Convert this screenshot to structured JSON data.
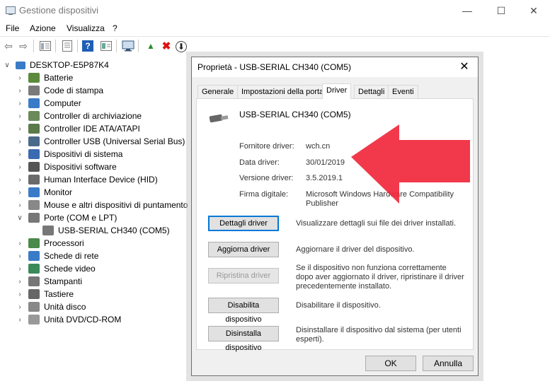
{
  "window": {
    "title": "Gestione dispositivi",
    "minimize_glyph": "—",
    "maximize_glyph": "☐",
    "close_glyph": "✕"
  },
  "menu": [
    "File",
    "Azione",
    "Visualizza",
    "?"
  ],
  "toolbar": {
    "icons": [
      "back-arrow-icon",
      "forward-arrow-icon",
      "show-hide-tree-icon",
      "properties-icon",
      "help-icon",
      "view-icon",
      "monitor-scan-icon",
      "update-driver-icon",
      "uninstall-icon",
      "disable-icon"
    ],
    "back_glyph": "⇦",
    "forward_glyph": "⇨",
    "help_glyph": "?",
    "update_glyph": "▲",
    "uninstall_glyph": "✖",
    "disable_glyph": "⬇"
  },
  "tree": {
    "root": "DESKTOP-E5P87K4",
    "expanded_glyph": "∨",
    "collapsed_glyph": "›",
    "items": [
      {
        "label": "Batterie",
        "icon": "battery-icon",
        "color": "#5a8a3a"
      },
      {
        "label": "Code di stampa",
        "icon": "printer-queue-icon",
        "color": "#7a7a7a"
      },
      {
        "label": "Computer",
        "icon": "computer-icon",
        "color": "#3a7bc8"
      },
      {
        "label": "Controller di archiviazione",
        "icon": "storage-controller-icon",
        "color": "#6a8a5a"
      },
      {
        "label": "Controller IDE ATA/ATAPI",
        "icon": "ide-controller-icon",
        "color": "#5a7a4a"
      },
      {
        "label": "Controller USB (Universal Serial Bus)",
        "icon": "usb-controller-icon",
        "color": "#4a6a8a"
      },
      {
        "label": "Dispositivi di sistema",
        "icon": "system-devices-icon",
        "color": "#3a6ab0"
      },
      {
        "label": "Dispositivi software",
        "icon": "software-devices-icon",
        "color": "#555555"
      },
      {
        "label": "Human Interface Device (HID)",
        "icon": "hid-icon",
        "color": "#6a6a6a"
      },
      {
        "label": "Monitor",
        "icon": "monitor-icon",
        "color": "#3a7bc8"
      },
      {
        "label": "Mouse e altri dispositivi di puntamento",
        "icon": "mouse-icon",
        "color": "#888888"
      },
      {
        "label": "Porte (COM e LPT)",
        "icon": "ports-icon",
        "color": "#777777"
      },
      {
        "label": "USB-SERIAL CH340 (COM5)",
        "icon": "serial-port-icon",
        "color": "#777777"
      },
      {
        "label": "Processori",
        "icon": "processor-icon",
        "color": "#4a8a4a"
      },
      {
        "label": "Schede di rete",
        "icon": "network-adapter-icon",
        "color": "#3a7bc8"
      },
      {
        "label": "Schede video",
        "icon": "display-adapter-icon",
        "color": "#3a8a5a"
      },
      {
        "label": "Stampanti",
        "icon": "printer-icon",
        "color": "#777777"
      },
      {
        "label": "Tastiere",
        "icon": "keyboard-icon",
        "color": "#666666"
      },
      {
        "label": "Unità disco",
        "icon": "disk-drive-icon",
        "color": "#888888"
      },
      {
        "label": "Unità DVD/CD-ROM",
        "icon": "dvd-drive-icon",
        "color": "#999999"
      }
    ]
  },
  "dialog": {
    "title": "Proprietà - USB-SERIAL CH340 (COM5)",
    "close_glyph": "✕",
    "tabs": [
      "Generale",
      "Impostazioni della porta",
      "Driver",
      "Dettagli",
      "Eventi"
    ],
    "active_tab": "Driver",
    "device_name": "USB-SERIAL CH340 (COM5)",
    "fields": [
      {
        "label": "Fornitore driver:",
        "value": "wch.cn"
      },
      {
        "label": "Data driver:",
        "value": "30/01/2019"
      },
      {
        "label": "Versione driver:",
        "value": "3.5.2019.1"
      },
      {
        "label": "Firma digitale:",
        "value": "Microsoft Windows Hardware Compatibility Publisher"
      }
    ],
    "buttons": [
      {
        "label": "Dettagli driver",
        "desc": "Visualizzare dettagli sui file dei driver installati."
      },
      {
        "label": "Aggiorna driver",
        "desc": "Aggiornare il driver del dispositivo."
      },
      {
        "label": "Ripristina driver",
        "desc": "Se il dispositivo non funziona correttamente dopo aver aggiornato il driver, ripristinare il driver precedentemente installato."
      },
      {
        "label": "Disabilita dispositivo",
        "desc": "Disabilitare il dispositivo."
      },
      {
        "label": "Disinstalla dispositivo",
        "desc": "Disinstallare il dispositivo dal sistema (per utenti esperti)."
      }
    ],
    "ok_label": "OK",
    "cancel_label": "Annulla"
  },
  "annotation": {
    "color": "#f0283c",
    "icon": "red-arrow-annotation-icon"
  }
}
